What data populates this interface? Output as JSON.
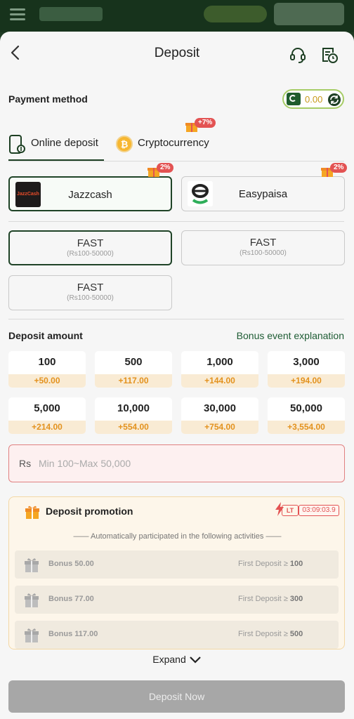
{
  "header": {
    "title": "Deposit"
  },
  "payment_method": {
    "label": "Payment method",
    "balance": "0.00"
  },
  "tabs": [
    {
      "label": "Online deposit",
      "selected": true
    },
    {
      "label": "Cryptocurrency",
      "badge": "+7%"
    }
  ],
  "methods": [
    {
      "label": "Jazzcash",
      "logo_text": "JazzCash",
      "badge": "2%",
      "selected": true
    },
    {
      "label": "Easypaisa",
      "badge": "2%",
      "selected": false
    }
  ],
  "channels": [
    {
      "name": "FAST",
      "range": "(Rs100-50000)",
      "selected": true
    },
    {
      "name": "FAST",
      "range": "(Rs100-50000)",
      "selected": false
    },
    {
      "name": "FAST",
      "range": "(Rs100-50000)",
      "selected": false
    }
  ],
  "amount": {
    "label": "Deposit amount",
    "bonus_link": "Bonus event explanation",
    "options": [
      {
        "value": "100",
        "bonus": "+50.00"
      },
      {
        "value": "500",
        "bonus": "+117.00"
      },
      {
        "value": "1,000",
        "bonus": "+144.00"
      },
      {
        "value": "3,000",
        "bonus": "+194.00"
      },
      {
        "value": "5,000",
        "bonus": "+214.00"
      },
      {
        "value": "10,000",
        "bonus": "+554.00"
      },
      {
        "value": "30,000",
        "bonus": "+754.00"
      },
      {
        "value": "50,000",
        "bonus": "+3,554.00"
      }
    ],
    "currency": "Rs",
    "input_value": "",
    "placeholder": "Min 100~Max 50,000"
  },
  "promotion": {
    "title": "Deposit promotion",
    "lt_tag": "LT",
    "timer": "03:09:03.9",
    "subtitle": "—— Automatically participated in the following activities ——",
    "activities": [
      {
        "name": "Bonus 50.00",
        "req_label": "First Deposit ≥",
        "req_value": "100"
      },
      {
        "name": "Bonus 77.00",
        "req_label": "First Deposit ≥",
        "req_value": "300"
      },
      {
        "name": "Bonus 117.00",
        "req_label": "First Deposit ≥",
        "req_value": "500"
      }
    ]
  },
  "expand_label": "Expand",
  "submit_label": "Deposit Now"
}
